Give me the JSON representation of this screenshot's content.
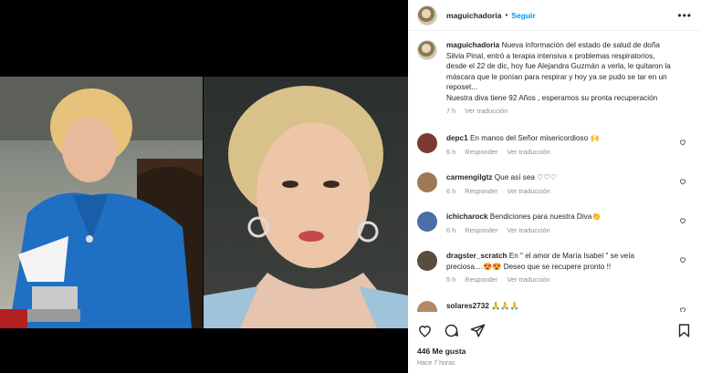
{
  "post": {
    "username": "maguichadoria",
    "follow_label": "Seguir",
    "separator": "•",
    "more_label": "•••"
  },
  "caption": {
    "username": "maguichadoria",
    "text": "Nueva información del estado de salud de doña Silvia Pinal, entró a terapia intensiva x problemas respiratorios, desde el 22 de dic, hoy fue Alejandra Guzmán a verla, le quitaron la máscara que le ponían para respirar y hoy ya se pudo se tar en un reposet...",
    "text2": "Nuestra diva tiene 92 Años , esperamos su pronta recuperación",
    "time": "7 h",
    "translate": "Ver traducción"
  },
  "comments": [
    {
      "username": "depc1",
      "text": "En manos del Señor misericordioso 🙌",
      "time": "6 h",
      "reply": "Responder",
      "translate": "Ver traducción",
      "avatar_color": "#7a3b2e"
    },
    {
      "username": "carmengilgtz",
      "text": "Que así sea ♡♡♡",
      "time": "6 h",
      "reply": "Responder",
      "translate": "Ver traducción",
      "avatar_color": "#9c7a55"
    },
    {
      "username": "ichicharock",
      "text": "Bendiciones para nuestra Diva👏",
      "time": "6 h",
      "reply": "Responder",
      "translate": "Ver traducción",
      "avatar_color": "#4a6fa5"
    },
    {
      "username": "dragster_scratch",
      "text": "En \" el amor de María Isabel \" se veía preciosa....😍😍 Deseo que se recupere pronto !!",
      "time": "5 h",
      "reply": "Responder",
      "translate": "Ver traducción",
      "avatar_color": "#5b4d3d"
    },
    {
      "username": "solares2732",
      "text": "🙏🙏🙏",
      "time": "",
      "reply": "",
      "translate": "",
      "avatar_color": "#b08968"
    }
  ],
  "stats": {
    "likes": "446 Me gusta",
    "posted": "Hace 7 horas"
  }
}
